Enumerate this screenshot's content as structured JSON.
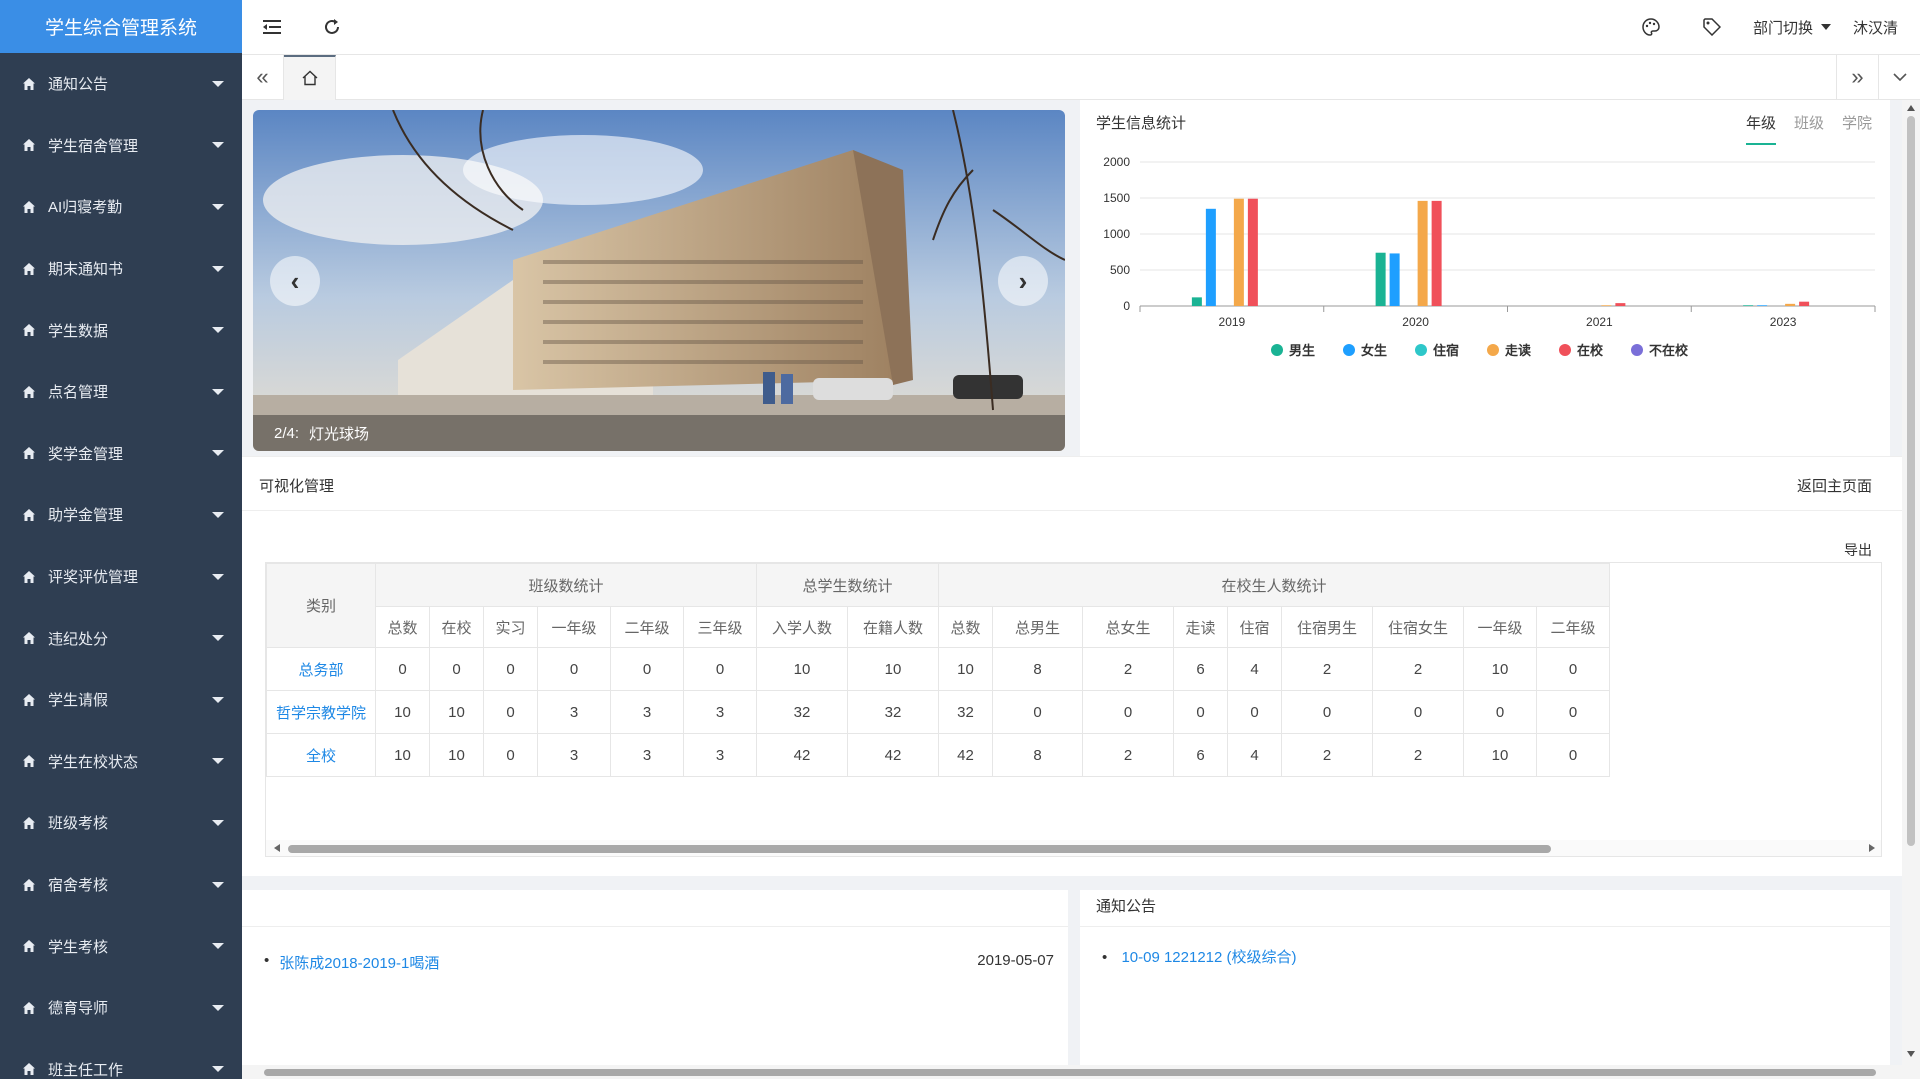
{
  "app": {
    "title": "学生综合管理系统"
  },
  "sidebar": {
    "items": [
      {
        "label": "通知公告"
      },
      {
        "label": "学生宿舍管理"
      },
      {
        "label": "AI归寝考勤"
      },
      {
        "label": "期末通知书"
      },
      {
        "label": "学生数据"
      },
      {
        "label": "点名管理"
      },
      {
        "label": "奖学金管理"
      },
      {
        "label": "助学金管理"
      },
      {
        "label": "评奖评优管理"
      },
      {
        "label": "违纪处分"
      },
      {
        "label": "学生请假"
      },
      {
        "label": "学生在校状态"
      },
      {
        "label": "班级考核"
      },
      {
        "label": "宿舍考核"
      },
      {
        "label": "学生考核"
      },
      {
        "label": "德育导师"
      },
      {
        "label": "班主任工作"
      }
    ]
  },
  "topbar": {
    "dept_switch": "部门切换",
    "username": "沐汉清"
  },
  "carousel": {
    "index": "2/4:",
    "caption": "灯光球场"
  },
  "stats": {
    "title": "学生信息统计",
    "tabs": [
      {
        "label": "年级",
        "active": true
      },
      {
        "label": "班级"
      },
      {
        "label": "学院"
      }
    ]
  },
  "chart_data": {
    "type": "bar",
    "categories": [
      "2019",
      "2020",
      "2021",
      "2023"
    ],
    "ylim": [
      0,
      2000
    ],
    "yticks": [
      0,
      500,
      1000,
      1500,
      2000
    ],
    "legend_position": "bottom",
    "series": [
      {
        "name": "男生",
        "color": "#1ab394",
        "values": [
          120,
          740,
          0,
          10
        ]
      },
      {
        "name": "女生",
        "color": "#1e9fff",
        "values": [
          1350,
          730,
          0,
          10
        ]
      },
      {
        "name": "住宿",
        "color": "#2ec7c9",
        "values": [
          0,
          0,
          0,
          0
        ]
      },
      {
        "name": "走读",
        "color": "#f4a84a",
        "values": [
          1490,
          1460,
          10,
          30
        ]
      },
      {
        "name": "在校",
        "color": "#f0505a",
        "values": [
          1490,
          1460,
          40,
          60
        ]
      },
      {
        "name": "不在校",
        "color": "#7a6fd8",
        "values": [
          0,
          0,
          0,
          0
        ]
      }
    ]
  },
  "viz": {
    "title": "可视化管理",
    "back": "返回主页面",
    "export": "导出",
    "table": {
      "category_header": "类别",
      "groups": [
        {
          "label": "班级数统计",
          "cols": [
            "总数",
            "在校",
            "实习",
            "一年级",
            "二年级",
            "三年级"
          ]
        },
        {
          "label": "总学生数统计",
          "cols": [
            "入学人数",
            "在籍人数"
          ]
        },
        {
          "label": "在校生人数统计",
          "cols": [
            "总数",
            "总男生",
            "总女生",
            "走读",
            "住宿",
            "住宿男生",
            "住宿女生",
            "一年级",
            "二年级"
          ]
        }
      ],
      "rows": [
        {
          "category": "总务部",
          "values": [
            "0",
            "0",
            "0",
            "0",
            "0",
            "0",
            "10",
            "10",
            "10",
            "8",
            "2",
            "6",
            "4",
            "2",
            "2",
            "10",
            "0"
          ]
        },
        {
          "category": "哲学宗教学院",
          "values": [
            "10",
            "10",
            "0",
            "3",
            "3",
            "3",
            "32",
            "32",
            "32",
            "0",
            "0",
            "0",
            "0",
            "0",
            "0",
            "0",
            "0"
          ]
        },
        {
          "category": "全校",
          "values": [
            "10",
            "10",
            "0",
            "3",
            "3",
            "3",
            "42",
            "42",
            "42",
            "8",
            "2",
            "6",
            "4",
            "2",
            "2",
            "10",
            "0"
          ]
        }
      ]
    }
  },
  "bottom_left": {
    "items": [
      {
        "title": "张陈成2018-2019-1喝酒",
        "date": "2019-05-07"
      }
    ]
  },
  "bottom_right": {
    "title": "通知公告",
    "items": [
      {
        "title": "10-09 1221212 (校级综合)"
      }
    ]
  }
}
